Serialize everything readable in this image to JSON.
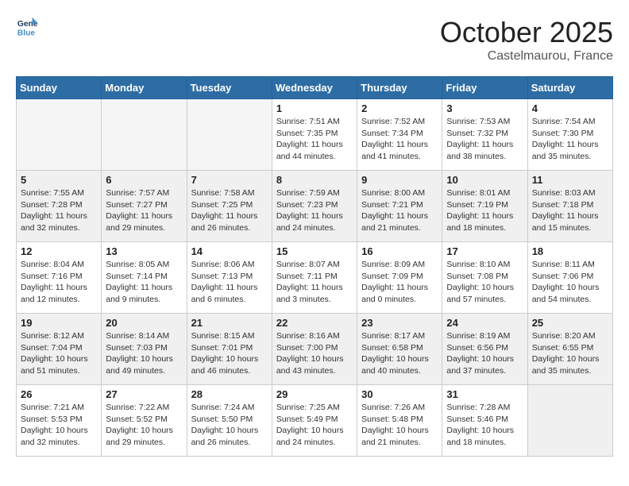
{
  "header": {
    "logo_line1": "General",
    "logo_line2": "Blue",
    "month": "October 2025",
    "location": "Castelmaurou, France"
  },
  "weekdays": [
    "Sunday",
    "Monday",
    "Tuesday",
    "Wednesday",
    "Thursday",
    "Friday",
    "Saturday"
  ],
  "weeks": [
    [
      {
        "day": "",
        "info": ""
      },
      {
        "day": "",
        "info": ""
      },
      {
        "day": "",
        "info": ""
      },
      {
        "day": "1",
        "info": "Sunrise: 7:51 AM\nSunset: 7:35 PM\nDaylight: 11 hours\nand 44 minutes."
      },
      {
        "day": "2",
        "info": "Sunrise: 7:52 AM\nSunset: 7:34 PM\nDaylight: 11 hours\nand 41 minutes."
      },
      {
        "day": "3",
        "info": "Sunrise: 7:53 AM\nSunset: 7:32 PM\nDaylight: 11 hours\nand 38 minutes."
      },
      {
        "day": "4",
        "info": "Sunrise: 7:54 AM\nSunset: 7:30 PM\nDaylight: 11 hours\nand 35 minutes."
      }
    ],
    [
      {
        "day": "5",
        "info": "Sunrise: 7:55 AM\nSunset: 7:28 PM\nDaylight: 11 hours\nand 32 minutes."
      },
      {
        "day": "6",
        "info": "Sunrise: 7:57 AM\nSunset: 7:27 PM\nDaylight: 11 hours\nand 29 minutes."
      },
      {
        "day": "7",
        "info": "Sunrise: 7:58 AM\nSunset: 7:25 PM\nDaylight: 11 hours\nand 26 minutes."
      },
      {
        "day": "8",
        "info": "Sunrise: 7:59 AM\nSunset: 7:23 PM\nDaylight: 11 hours\nand 24 minutes."
      },
      {
        "day": "9",
        "info": "Sunrise: 8:00 AM\nSunset: 7:21 PM\nDaylight: 11 hours\nand 21 minutes."
      },
      {
        "day": "10",
        "info": "Sunrise: 8:01 AM\nSunset: 7:19 PM\nDaylight: 11 hours\nand 18 minutes."
      },
      {
        "day": "11",
        "info": "Sunrise: 8:03 AM\nSunset: 7:18 PM\nDaylight: 11 hours\nand 15 minutes."
      }
    ],
    [
      {
        "day": "12",
        "info": "Sunrise: 8:04 AM\nSunset: 7:16 PM\nDaylight: 11 hours\nand 12 minutes."
      },
      {
        "day": "13",
        "info": "Sunrise: 8:05 AM\nSunset: 7:14 PM\nDaylight: 11 hours\nand 9 minutes."
      },
      {
        "day": "14",
        "info": "Sunrise: 8:06 AM\nSunset: 7:13 PM\nDaylight: 11 hours\nand 6 minutes."
      },
      {
        "day": "15",
        "info": "Sunrise: 8:07 AM\nSunset: 7:11 PM\nDaylight: 11 hours\nand 3 minutes."
      },
      {
        "day": "16",
        "info": "Sunrise: 8:09 AM\nSunset: 7:09 PM\nDaylight: 11 hours\nand 0 minutes."
      },
      {
        "day": "17",
        "info": "Sunrise: 8:10 AM\nSunset: 7:08 PM\nDaylight: 10 hours\nand 57 minutes."
      },
      {
        "day": "18",
        "info": "Sunrise: 8:11 AM\nSunset: 7:06 PM\nDaylight: 10 hours\nand 54 minutes."
      }
    ],
    [
      {
        "day": "19",
        "info": "Sunrise: 8:12 AM\nSunset: 7:04 PM\nDaylight: 10 hours\nand 51 minutes."
      },
      {
        "day": "20",
        "info": "Sunrise: 8:14 AM\nSunset: 7:03 PM\nDaylight: 10 hours\nand 49 minutes."
      },
      {
        "day": "21",
        "info": "Sunrise: 8:15 AM\nSunset: 7:01 PM\nDaylight: 10 hours\nand 46 minutes."
      },
      {
        "day": "22",
        "info": "Sunrise: 8:16 AM\nSunset: 7:00 PM\nDaylight: 10 hours\nand 43 minutes."
      },
      {
        "day": "23",
        "info": "Sunrise: 8:17 AM\nSunset: 6:58 PM\nDaylight: 10 hours\nand 40 minutes."
      },
      {
        "day": "24",
        "info": "Sunrise: 8:19 AM\nSunset: 6:56 PM\nDaylight: 10 hours\nand 37 minutes."
      },
      {
        "day": "25",
        "info": "Sunrise: 8:20 AM\nSunset: 6:55 PM\nDaylight: 10 hours\nand 35 minutes."
      }
    ],
    [
      {
        "day": "26",
        "info": "Sunrise: 7:21 AM\nSunset: 5:53 PM\nDaylight: 10 hours\nand 32 minutes."
      },
      {
        "day": "27",
        "info": "Sunrise: 7:22 AM\nSunset: 5:52 PM\nDaylight: 10 hours\nand 29 minutes."
      },
      {
        "day": "28",
        "info": "Sunrise: 7:24 AM\nSunset: 5:50 PM\nDaylight: 10 hours\nand 26 minutes."
      },
      {
        "day": "29",
        "info": "Sunrise: 7:25 AM\nSunset: 5:49 PM\nDaylight: 10 hours\nand 24 minutes."
      },
      {
        "day": "30",
        "info": "Sunrise: 7:26 AM\nSunset: 5:48 PM\nDaylight: 10 hours\nand 21 minutes."
      },
      {
        "day": "31",
        "info": "Sunrise: 7:28 AM\nSunset: 5:46 PM\nDaylight: 10 hours\nand 18 minutes."
      },
      {
        "day": "",
        "info": ""
      }
    ]
  ]
}
